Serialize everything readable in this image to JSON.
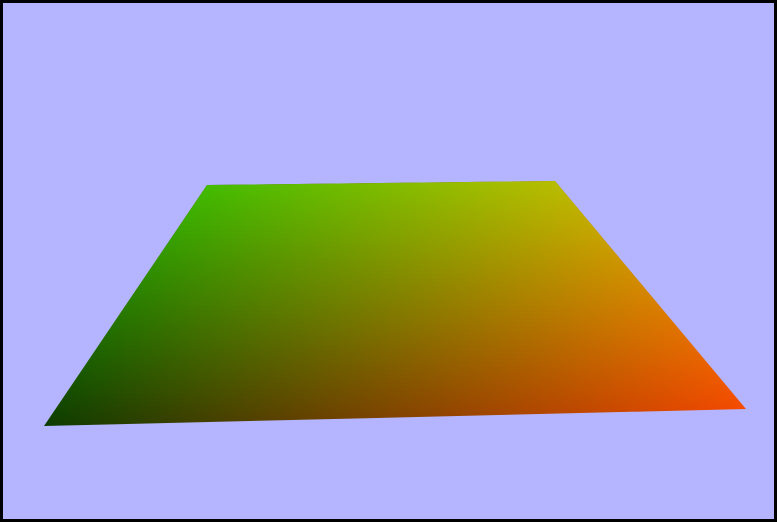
{
  "scene": {
    "background_color": "#b5b5ff",
    "border_color": "#000000",
    "plane": {
      "corner_colors": {
        "back_left": "#00c000",
        "back_right": "#ffc000",
        "front_left": "#003a00",
        "front_right": "#ff4000"
      },
      "center_color": "#808000"
    }
  }
}
